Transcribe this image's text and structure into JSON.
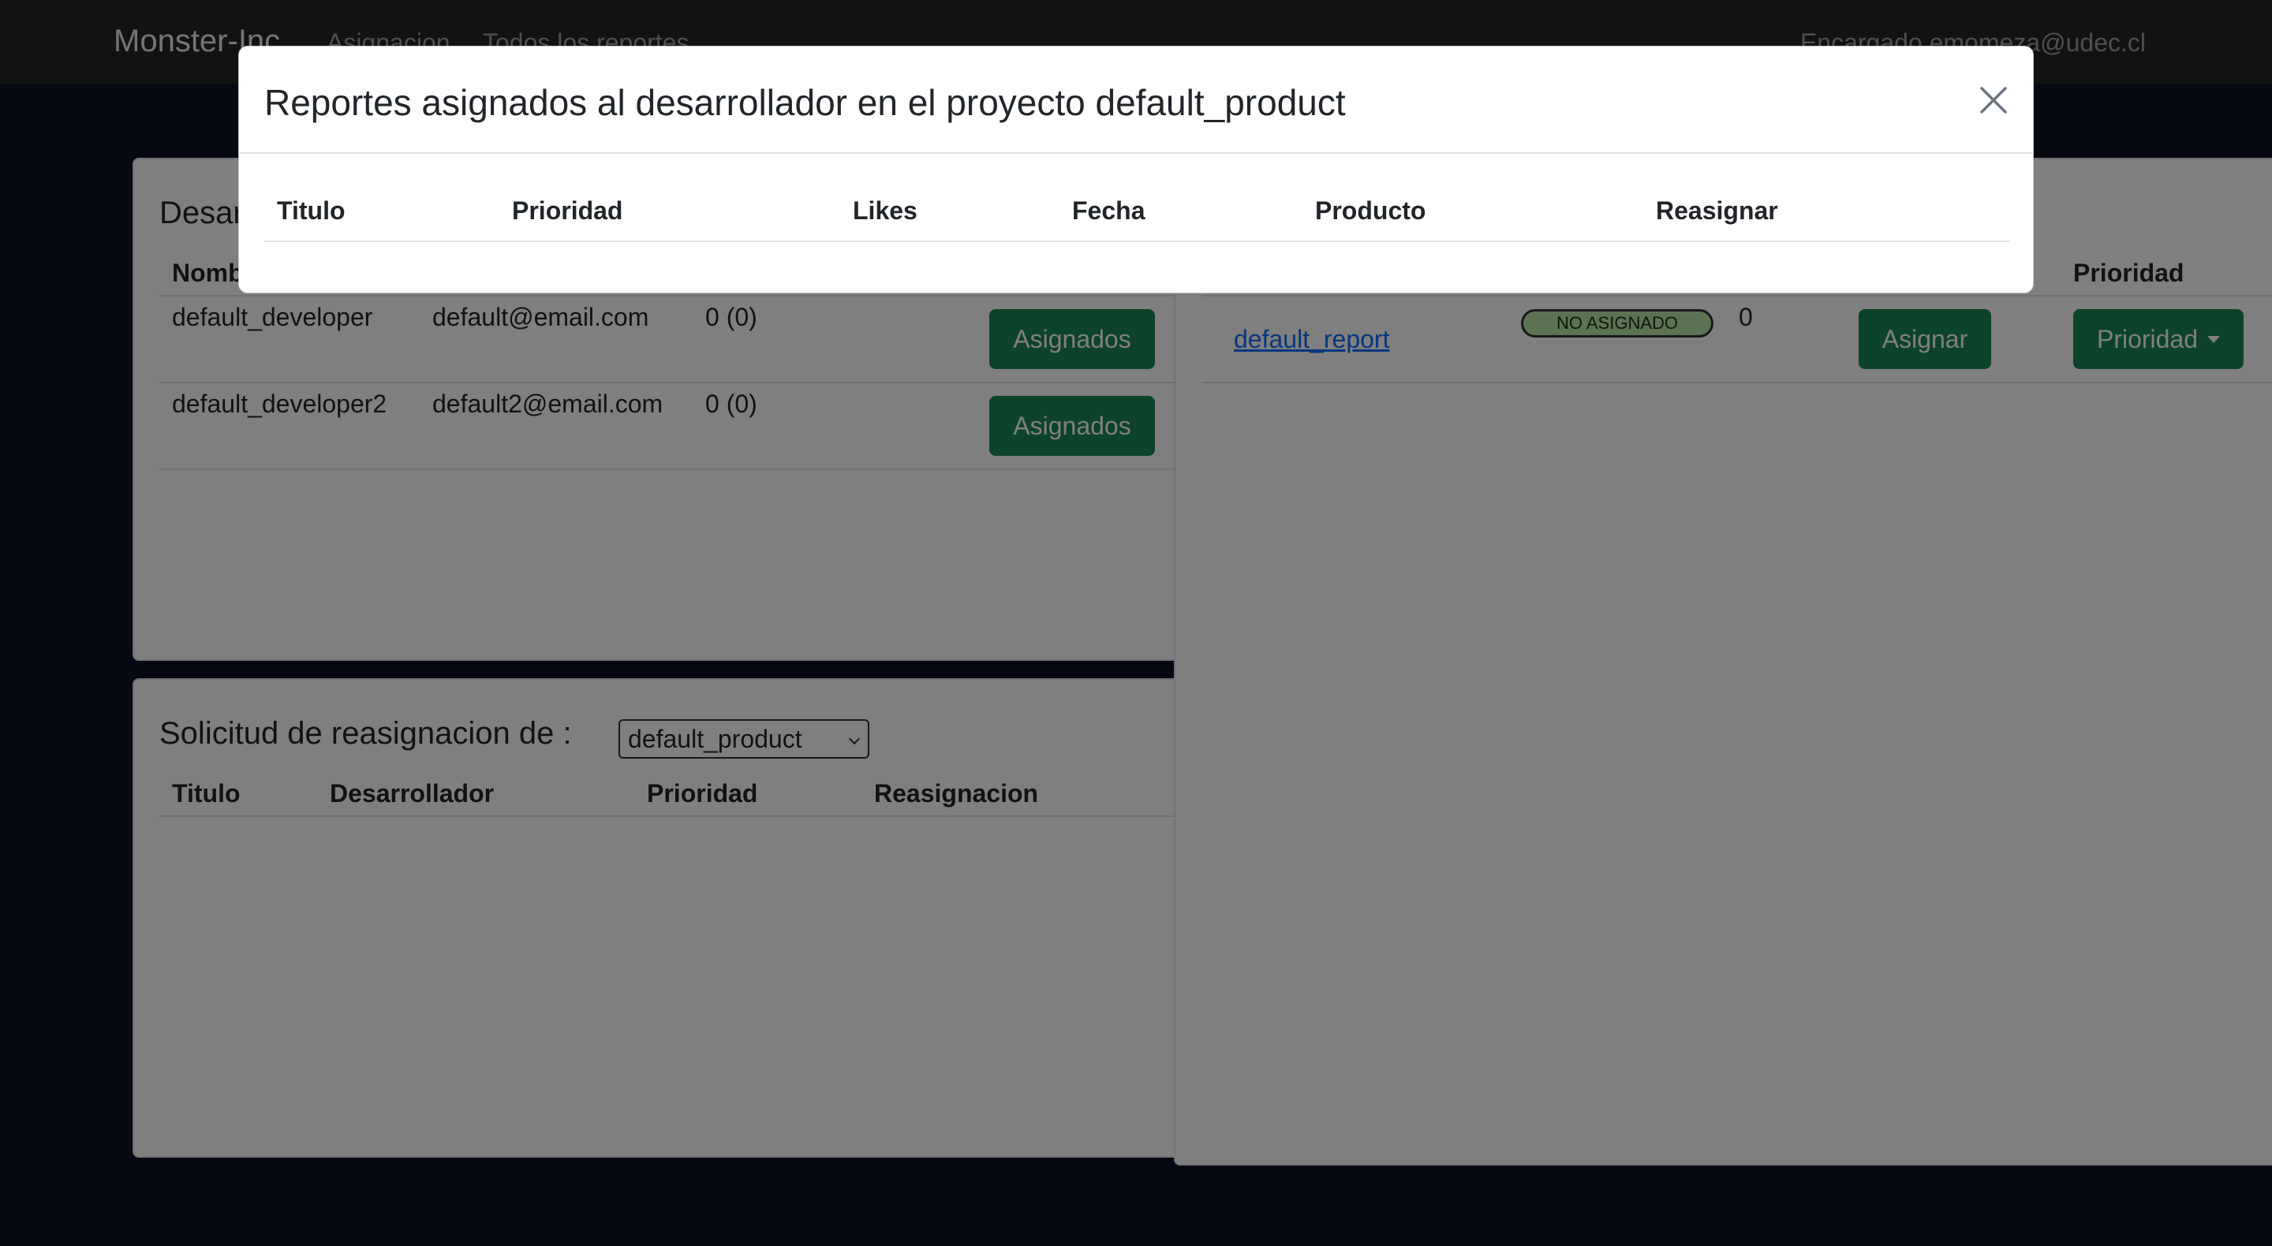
{
  "navbar": {
    "brand": "Monster-Inc",
    "links": [
      "Asignacion",
      "Todos los reportes"
    ],
    "user": "Encargado emomeza@udec.cl"
  },
  "developers_card": {
    "title": "Desarrolladores",
    "columns": [
      "Nombre"
    ],
    "rows": [
      {
        "name": "default_developer",
        "email": "default@email.com",
        "count": "0 (0)",
        "button": "Asignados"
      },
      {
        "name": "default_developer2",
        "email": "default2@email.com",
        "count": "0 (0)",
        "button": "Asignados"
      }
    ]
  },
  "reassign_card": {
    "title": "Solicitud de reasignacion de :",
    "select_value": "default_product",
    "columns": [
      "Titulo",
      "Desarrollador",
      "Prioridad",
      "Reasignacion"
    ]
  },
  "reports_card": {
    "columns": [
      "Prioridad"
    ],
    "row": {
      "title": "default_report",
      "status": "NO ASIGNADO",
      "likes": "0",
      "assign_button": "Asignar",
      "priority_button": "Prioridad"
    }
  },
  "modal": {
    "title": "Reportes asignados al desarrollador en el proyecto default_product",
    "columns": [
      "Titulo",
      "Prioridad",
      "Likes",
      "Fecha",
      "Producto",
      "Reasignar"
    ]
  },
  "colors": {
    "navbar": "#212529",
    "page_background": "#0c1322",
    "button_green": "#198754",
    "badge": "#b6e6a4",
    "link": "#0d6efd"
  },
  "icons": [
    "close-icon",
    "caret-down-icon",
    "chevron-down-icon"
  ]
}
